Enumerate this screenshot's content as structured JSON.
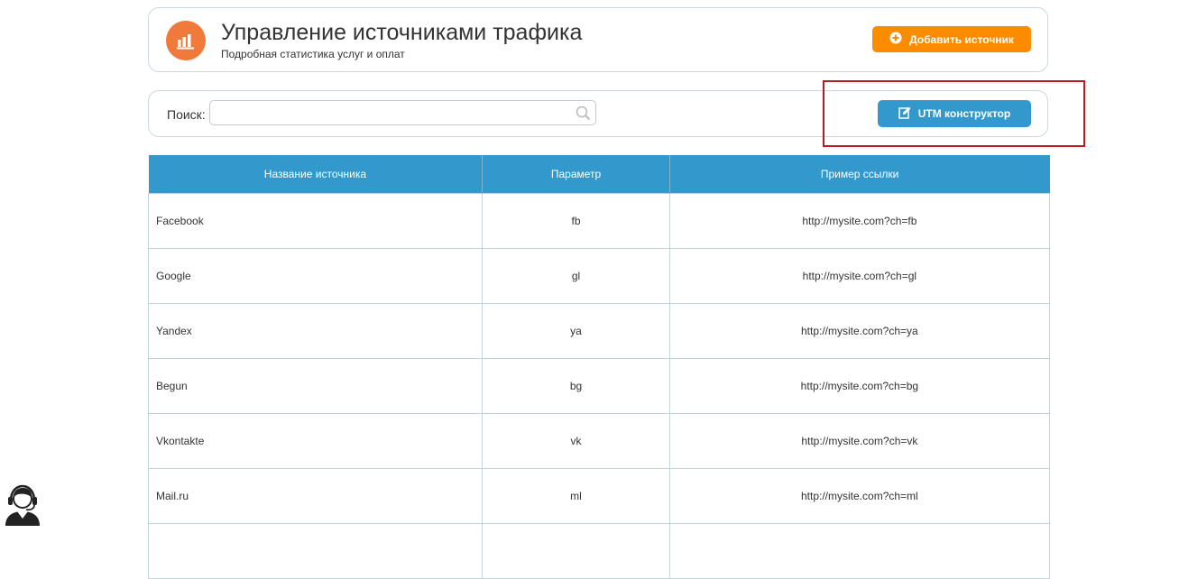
{
  "header": {
    "title": "Управление источниками трафика",
    "subtitle": "Подробная статистика услуг и оплат",
    "add_button_label": "Добавить источник",
    "logo_icon": "bar-chart-icon",
    "accent_color": "#f07a3c",
    "add_button_color": "#fb8c00"
  },
  "search": {
    "label": "Поиск:",
    "value": "",
    "placeholder": "",
    "icon": "search-icon"
  },
  "utm_button": {
    "label": "UTM конструктор",
    "icon": "edit-icon",
    "color": "#3399cc"
  },
  "table": {
    "headers": [
      "Название источника",
      "Параметр",
      "Пример ссылки"
    ],
    "rows": [
      {
        "name": "Facebook",
        "param": "fb",
        "link": "http://mysite.com?ch=fb"
      },
      {
        "name": "Google",
        "param": "gl",
        "link": "http://mysite.com?ch=gl"
      },
      {
        "name": "Yandex",
        "param": "ya",
        "link": "http://mysite.com?ch=ya"
      },
      {
        "name": "Begun",
        "param": "bg",
        "link": "http://mysite.com?ch=bg"
      },
      {
        "name": "Vkontakte",
        "param": "vk",
        "link": "http://mysite.com?ch=vk"
      },
      {
        "name": "Mail.ru",
        "param": "ml",
        "link": "http://mysite.com?ch=ml"
      },
      {
        "name": "",
        "param": "",
        "link": ""
      }
    ]
  },
  "support": {
    "icon": "support-agent-icon"
  },
  "annotation": {
    "highlight_color": "#b81c22"
  }
}
